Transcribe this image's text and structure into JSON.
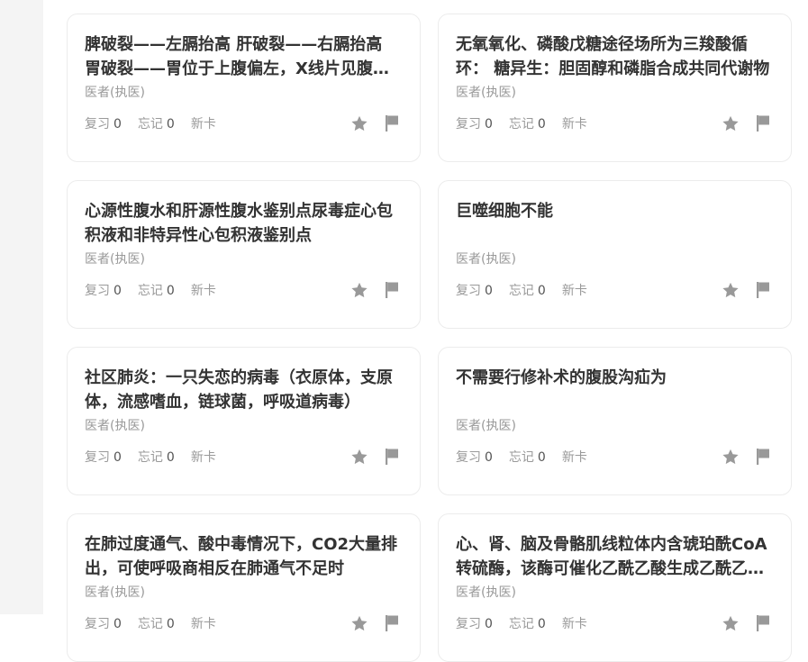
{
  "stats_labels": {
    "review": "复习",
    "forget": "忘记",
    "new_card": "新卡"
  },
  "colors": {
    "icon": "#999999",
    "title": "#333333",
    "muted": "#999999",
    "rail": "#f4f4f4"
  },
  "icons": {
    "star": "star-icon",
    "flag": "flag-icon"
  },
  "cards": [
    {
      "title": "",
      "tag": "",
      "review": "",
      "forget": ""
    },
    {
      "title": "",
      "tag": "",
      "review": "",
      "forget": ""
    },
    {
      "title": "脾破裂——左膈抬高 肝破裂——右膈抬高 胃破裂——胃位于上腹偏左，X线片见腹腔游离气体",
      "tag": "医者(执医)",
      "review": "0",
      "forget": "0"
    },
    {
      "title": "无氧氧化、磷酸戊糖途径场所为三羧酸循环： 糖异生：胆固醇和磷脂合成共同代谢物",
      "tag": "医者(执医)",
      "review": "0",
      "forget": "0"
    },
    {
      "title": "心源性腹水和肝源性腹水鉴别点尿毒症心包积液和非特异性心包积液鉴别点",
      "tag": "医者(执医)",
      "review": "0",
      "forget": "0"
    },
    {
      "title": "巨噬细胞不能",
      "tag": "医者(执医)",
      "review": "0",
      "forget": "0"
    },
    {
      "title": "社区肺炎：一只失恋的病毒（衣原体，支原体，流感嗜血，链球菌，呼吸道病毒）",
      "tag": "医者(执医)",
      "review": "0",
      "forget": "0"
    },
    {
      "title": "不需要行修补术的腹股沟疝为",
      "tag": "医者(执医)",
      "review": "0",
      "forget": "0"
    },
    {
      "title": "在肺过度通气、酸中毒情况下，CO2大量排出，可使呼吸商相反在肺通气不足时",
      "tag": "医者(执医)",
      "review": "0",
      "forget": "0"
    },
    {
      "title": "心、肾、脑及骨骼肌线粒体内含琥珀酰CoA转硫酶，该酶可催化乙酰乙酸生成乙酰乙酰CoA",
      "tag": "医者(执医)",
      "review": "0",
      "forget": "0"
    }
  ]
}
